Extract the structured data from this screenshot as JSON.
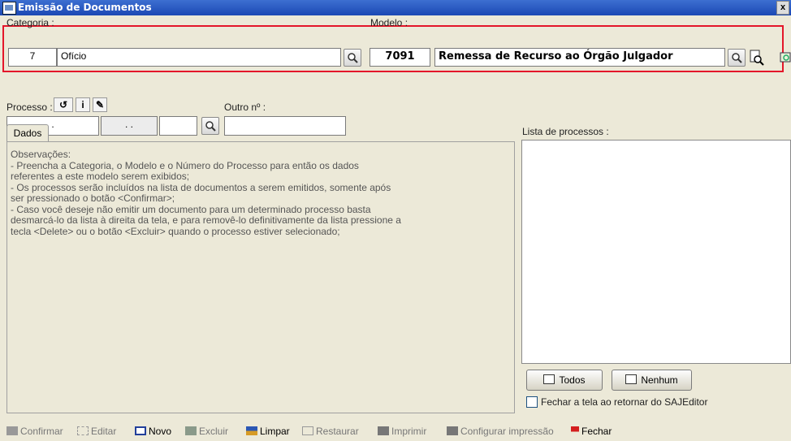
{
  "window": {
    "title": "Emissão de Documentos",
    "close_glyph": "x"
  },
  "categoria": {
    "label": "Categoria :",
    "code": "7",
    "name": "Ofício"
  },
  "modelo": {
    "label": "Modelo :",
    "code": "7091",
    "name": "Remessa de Recurso ao Órgão Julgador"
  },
  "processo": {
    "label": "Processo :",
    "part1": "  .  ",
    "part2": ". .",
    "part3": "",
    "outro_label": "Outro nº :",
    "outro_value": ""
  },
  "tabs": {
    "dados": "Dados"
  },
  "observacoes": [
    "Observações:",
    "  - Preencha a Categoria, o Modelo e o Número do Processo para então os dados",
    "referentes a este modelo serem exibidos;",
    "  - Os processos serão incluídos na lista de documentos a serem emitidos, somente após",
    "ser pressionado o botão <Confirmar>;",
    "  - Caso você deseje não emitir um documento para um determinado processo basta",
    "desmarcá-lo da lista à direita da tela, e para removê-lo definitivamente da lista pressione a",
    "tecla <Delete> ou o botão <Excluir> quando o processo estiver selecionado;"
  ],
  "lista": {
    "label": "Lista de processos :",
    "items": []
  },
  "buttons": {
    "todos": "Todos",
    "nenhum": "Nenhum"
  },
  "checkbox": {
    "label": "Fechar a tela ao retornar do SAJEditor",
    "checked": false
  },
  "toolbar": [
    {
      "label": "Confirmar",
      "enabled": false,
      "icon": "confirm-icon"
    },
    {
      "label": "Editar",
      "enabled": false,
      "icon": "edit-icon"
    },
    {
      "label": "Novo",
      "enabled": true,
      "icon": "new-icon"
    },
    {
      "label": "Excluir",
      "enabled": false,
      "icon": "delete-icon"
    },
    {
      "label": "Limpar",
      "enabled": true,
      "icon": "clear-icon"
    },
    {
      "label": "Restaurar",
      "enabled": false,
      "icon": "restore-icon"
    },
    {
      "label": "Imprimir",
      "enabled": false,
      "icon": "print-icon"
    },
    {
      "label": "Configurar impressão",
      "enabled": false,
      "icon": "print-setup-icon"
    },
    {
      "label": "Fechar",
      "enabled": true,
      "icon": "close-flag-icon"
    }
  ],
  "colors": {
    "title_bg": "#2355c4",
    "highlight": "#e4162a",
    "window_bg": "#ece9d8"
  }
}
